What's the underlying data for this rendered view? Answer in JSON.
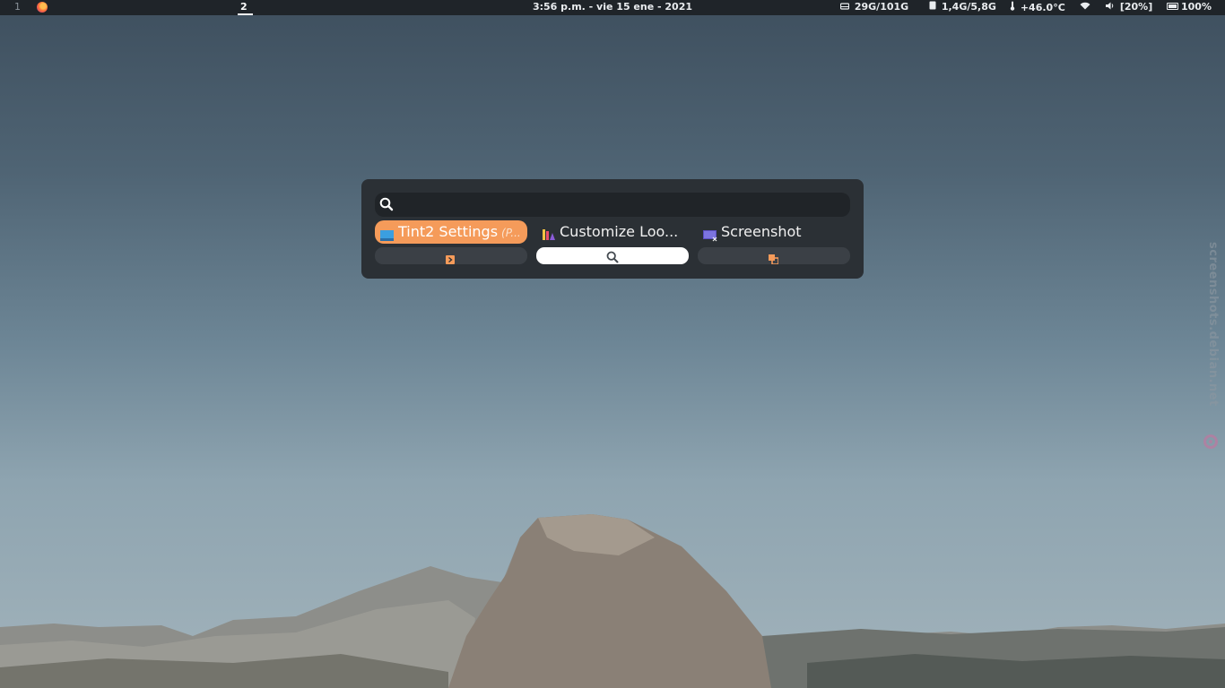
{
  "topbar": {
    "workspace_1": "1",
    "workspace_2": "2",
    "clock": "3:56 p.m. - vie 15 ene - 2021",
    "disk": "29G/101G",
    "memory": "1,4G/5,8G",
    "temperature": "+46.0°C",
    "volume": "[20%]",
    "battery": "100%"
  },
  "launcher": {
    "search": {
      "value": "",
      "placeholder": ""
    },
    "results": [
      {
        "label": "Tint2 Settings",
        "sub": "(P...",
        "icon": "tint2-settings-icon"
      },
      {
        "label": "Customize Loo...",
        "icon": "customize-look-icon"
      },
      {
        "label": "Screenshot",
        "icon": "screenshot-icon"
      }
    ],
    "actions": [
      {
        "icon": "run-arrow-icon"
      },
      {
        "icon": "search-icon"
      },
      {
        "icon": "window-switch-icon"
      }
    ]
  },
  "watermark": "screenshots.debian.net",
  "colors": {
    "accent": "#f59b5a",
    "launcher_bg": "#2b3035",
    "topbar_bg": "#1f2429"
  }
}
